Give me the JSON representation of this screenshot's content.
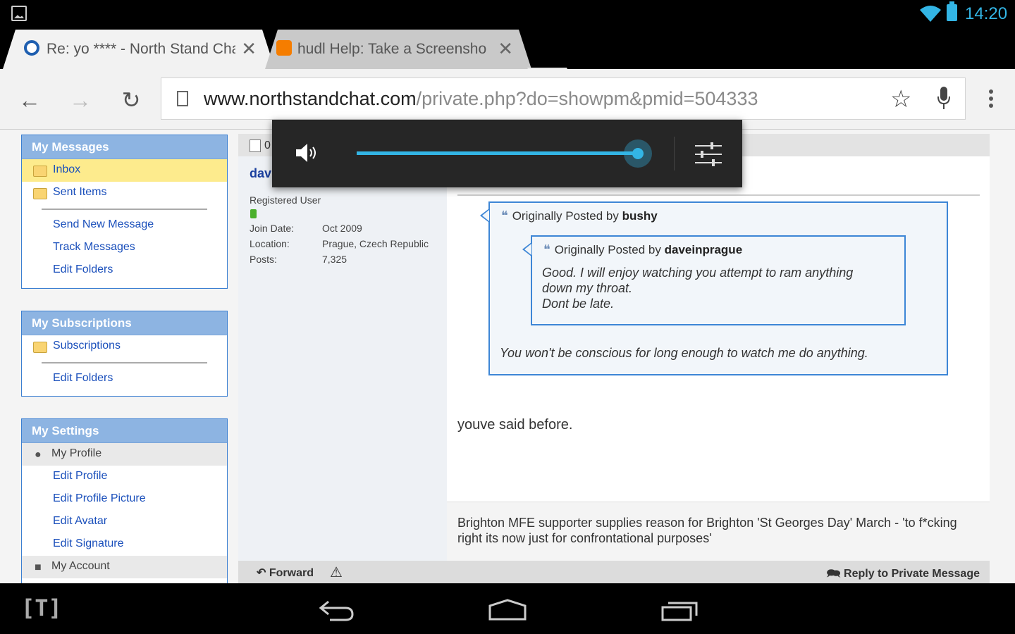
{
  "status_bar": {
    "time": "14:20"
  },
  "tabs": [
    {
      "title": "Re: yo **** - North Stand Chat",
      "close": "✕",
      "active": true,
      "favicon_color": "#1f5fb0"
    },
    {
      "title": "hudl Help: Take a Screenshot",
      "close": "✕",
      "active": false,
      "favicon_color": "#f57d00"
    }
  ],
  "toolbar": {
    "back": "←",
    "forward": "→",
    "reload": "↻",
    "url_host": "www.northstandchat.com",
    "url_path": "/private.php?do=showpm&pmid=504333",
    "star": "☆"
  },
  "sidebar": {
    "messages": {
      "heading": "My Messages",
      "folders": [
        "Inbox",
        "Sent Items"
      ],
      "links": [
        "Send New Message",
        "Track Messages",
        "Edit Folders"
      ]
    },
    "subscriptions": {
      "heading": "My Subscriptions",
      "folders": [
        "Subscriptions"
      ],
      "links": [
        "Edit Folders"
      ]
    },
    "settings": {
      "heading": "My Settings",
      "profile_header": "My Profile",
      "links": [
        "Edit Profile",
        "Edit Profile Picture",
        "Edit Avatar",
        "Edit Signature"
      ],
      "account_header": "My Account"
    }
  },
  "post": {
    "header_num": "0",
    "username": "dav",
    "user_title": "Registered User",
    "info": [
      {
        "label": "Join Date:",
        "value": "Oct 2009"
      },
      {
        "label": "Location:",
        "value": "Prague, Czech Republic"
      },
      {
        "label": "Posts:",
        "value": "7,325"
      }
    ],
    "outer_quote": {
      "prefix": "Originally Posted by",
      "author": "bushy",
      "text": "You won't be conscious for long enough to watch me do anything."
    },
    "inner_quote": {
      "prefix": "Originally Posted by",
      "author": "daveinprague",
      "text_lines": [
        "Good. I will enjoy watching you attempt to ram anything",
        "down my throat.",
        "Dont be late."
      ]
    },
    "reply": "youve said before.",
    "signature": "Brighton MFE supporter supplies reason for Brighton 'St Georges Day' March - 'to f*cking right its now just for confrontational purposes'",
    "footer": {
      "forward": "Forward",
      "reply": "Reply to Private Message"
    }
  },
  "volume": {
    "level": 0.95
  },
  "nav_bar": {
    "logo": "[T]"
  }
}
